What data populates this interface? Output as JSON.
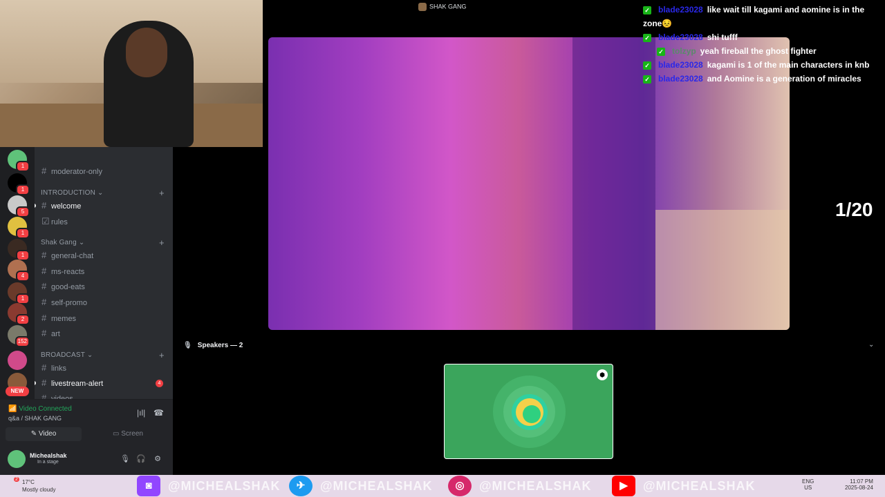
{
  "stage": {
    "title": "SHAK GANG"
  },
  "stream": {
    "counter": "1/20"
  },
  "speakers": {
    "label": "Speakers — 2",
    "chevron": "⌄"
  },
  "chat": [
    {
      "user": "blade23028",
      "text": "like wait till kagami and aomine is in the zone😣"
    },
    {
      "user": "blade23028",
      "text": "shi tufff"
    },
    {
      "user": "tolzyp",
      "text": "yeah fireball the ghost fighter"
    },
    {
      "user": "blade23028",
      "text": "kagami is 1 of the main characters in knb"
    },
    {
      "user": "blade23028",
      "text": "and Aomine is a generation of miracles"
    }
  ],
  "servers": [
    {
      "badge": "1",
      "color": "#5fc27a"
    },
    {
      "badge": "1",
      "color": "#000000"
    },
    {
      "badge": "5",
      "color": "#c9c9c9"
    },
    {
      "badge": "1",
      "color": "#e0c040"
    },
    {
      "badge": "1",
      "color": "#3a2a22"
    },
    {
      "badge": "4",
      "color": "#b07050"
    },
    {
      "badge": "1",
      "color": "#6a3a2a"
    },
    {
      "badge": "2",
      "color": "#8a3a30"
    },
    {
      "badge": "152",
      "color": "#7a7a6a"
    },
    {
      "badge": "",
      "color": "#d04a8a"
    },
    {
      "badge": "",
      "color": "#8a5a3a"
    }
  ],
  "new_label": "NEW",
  "channels": {
    "top_item": "moderator-only",
    "categories": [
      {
        "name": "INTRODUCTION",
        "items": [
          "welcome",
          "rules"
        ]
      },
      {
        "name": "Shak Gang",
        "items": [
          "general-chat",
          "ms-reacts",
          "good-eats",
          "self-promo",
          "memes",
          "art"
        ]
      },
      {
        "name": "BROADCAST",
        "items": [
          "links",
          "livestream-alert",
          "videos"
        ]
      }
    ],
    "livestream_count": "4"
  },
  "voice": {
    "status": "Video Connected",
    "where": "q&a / SHAK GANG",
    "video_label": "Video",
    "screen_label": "Screen"
  },
  "user": {
    "name": "Michealshak",
    "status": "In a stage"
  },
  "taskbar": {
    "temp": "17°C",
    "weather": "Mostly cloudy",
    "weather_badge": "2",
    "brand": "@MICHEALSHAK",
    "lang": "ENG",
    "region": "US",
    "time": "11:07 PM",
    "date": "2025-08-24"
  }
}
